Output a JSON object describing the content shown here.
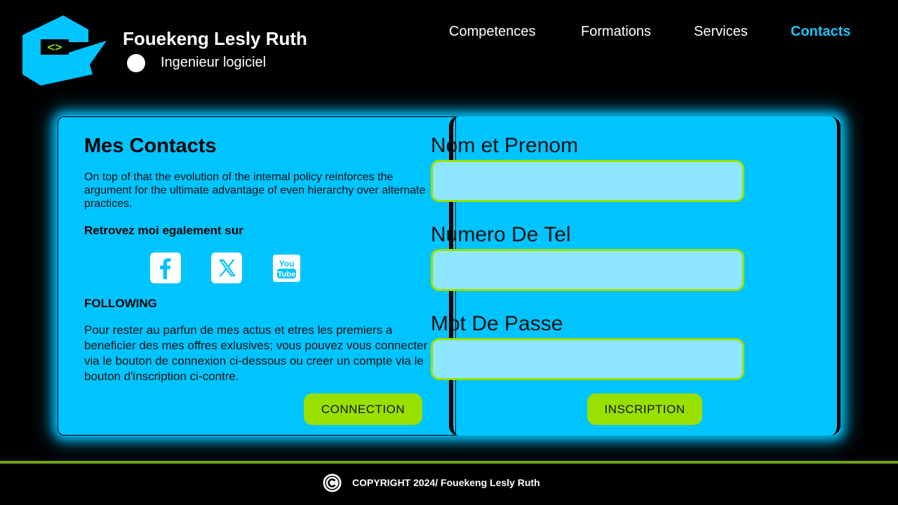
{
  "header": {
    "name": "Fouekeng Lesly Ruth",
    "role": "Ingenieur logiciel",
    "logo_text": "<>"
  },
  "nav": {
    "items": [
      {
        "label": "Competences",
        "active": false
      },
      {
        "label": "Formations",
        "active": false
      },
      {
        "label": "Services",
        "active": false
      },
      {
        "label": "Contacts",
        "active": true
      }
    ]
  },
  "contacts": {
    "title": "Mes Contacts",
    "description": "On top of that the evolution of the internal policy reinforces the argument for the ultimate advantage of even hierarchy over alternate practices.",
    "find_me": "Retrovez moi egalement sur",
    "socials": [
      {
        "name": "facebook",
        "icon": "facebook-icon"
      },
      {
        "name": "x",
        "icon": "x-icon"
      },
      {
        "name": "youtube",
        "icon": "youtube-icon",
        "text_top": "You",
        "text_bottom": "Tube"
      }
    ],
    "following_title": "FOLLOWING",
    "following_text": "Pour rester au parfun de mes actus et etres les premiers a beneficier des mes offres exlusives; vous pouvez vous connecter via le bouton de connexion ci-dessous ou creer un compte via le bouton d'inscription ci-contre.",
    "connection_button": "CONNECTION"
  },
  "form": {
    "fields": [
      {
        "label": "Nom et Prenom",
        "value": ""
      },
      {
        "label": "Numero De Tel",
        "value": ""
      },
      {
        "label": "Mot De Passe",
        "value": ""
      }
    ],
    "submit_button": "INSCRIPTION"
  },
  "footer": {
    "copyright": "COPYRIGHT 2024/ Fouekeng Lesly Ruth"
  },
  "colors": {
    "accent_blue": "#00c4ff",
    "accent_green": "#99e000",
    "nav_active": "#1ec3f5",
    "background": "#000000"
  }
}
